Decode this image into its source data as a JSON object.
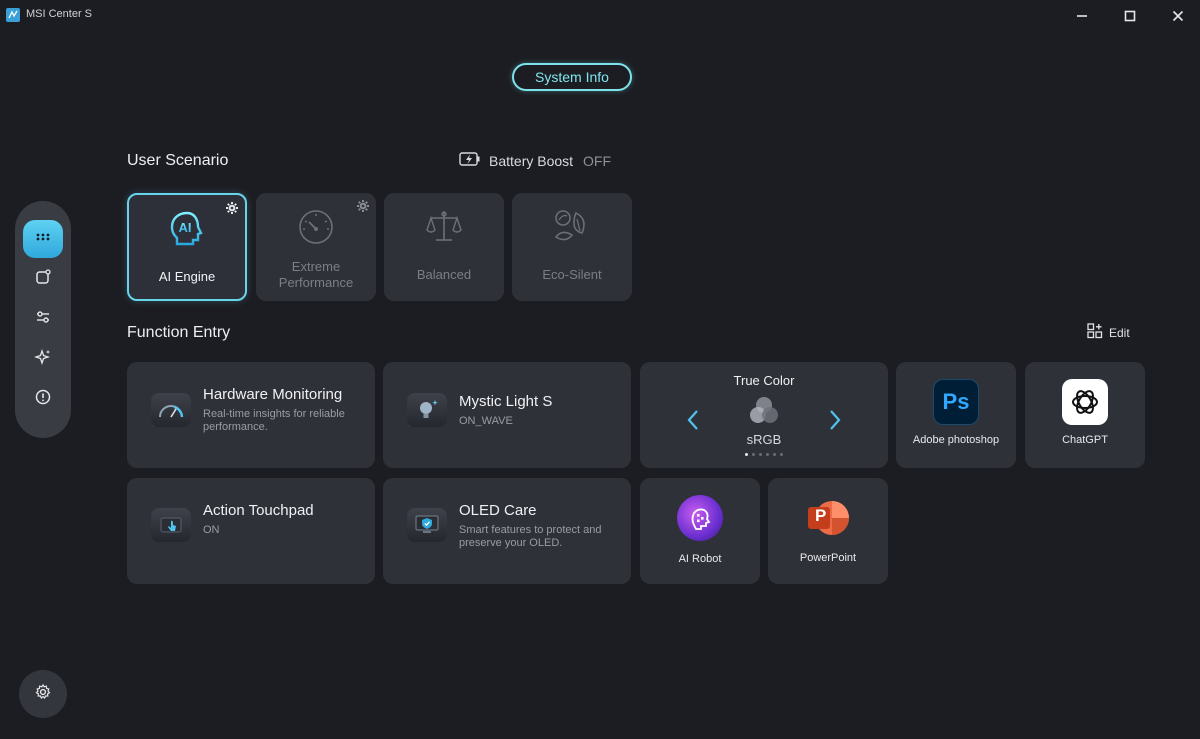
{
  "window": {
    "title": "MSI Center S"
  },
  "header": {
    "system_info_label": "System Info"
  },
  "user_scenario": {
    "title": "User Scenario",
    "battery_boost_label": "Battery Boost",
    "battery_boost_state": "OFF",
    "modes": [
      {
        "label": "AI Engine",
        "active": true,
        "has_settings": true
      },
      {
        "label": "Extreme Performance",
        "line1": "Extreme",
        "line2": "Performance",
        "active": false,
        "has_settings": true
      },
      {
        "label": "Balanced",
        "active": false,
        "has_settings": false
      },
      {
        "label": "Eco-Silent",
        "active": false,
        "has_settings": false
      }
    ]
  },
  "function_entry": {
    "title": "Function Entry",
    "edit_label": "Edit",
    "hardware_monitoring": {
      "title": "Hardware Monitoring",
      "subtitle": "Real-time insights for reliable performance."
    },
    "mystic_light": {
      "title": "Mystic Light S",
      "subtitle": "ON_WAVE"
    },
    "true_color": {
      "title": "True Color",
      "value": "sRGB",
      "page_count": 6,
      "current_page": 1
    },
    "adobe_photoshop": {
      "label": "Adobe photoshop",
      "icon_text": "Ps"
    },
    "chatgpt": {
      "label": "ChatGPT"
    },
    "action_touchpad": {
      "title": "Action Touchpad",
      "subtitle": "ON"
    },
    "oled_care": {
      "title": "OLED Care",
      "subtitle": "Smart features to protect and preserve your OLED."
    },
    "ai_robot": {
      "label": "AI Robot"
    },
    "powerpoint": {
      "label": "PowerPoint",
      "icon_text": "P"
    }
  },
  "colors": {
    "accent": "#68d4ea",
    "background": "#1c1d22",
    "card": "#2f3138",
    "sidebar": "#3a3c44"
  },
  "sidebar_icons": [
    "apps-grid-icon",
    "device-icon",
    "sliders-icon",
    "sparkle-icon",
    "alert-icon"
  ]
}
